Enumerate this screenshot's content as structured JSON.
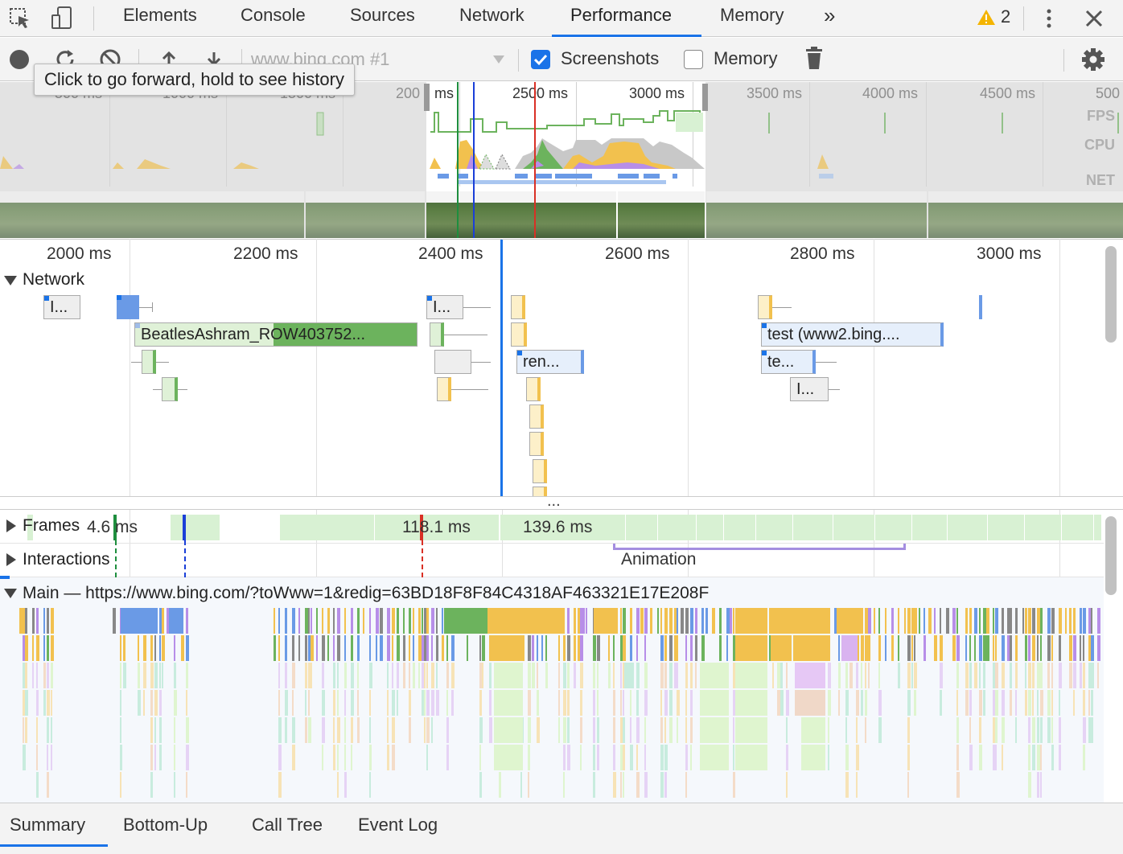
{
  "tabs": [
    {
      "label": "Elements"
    },
    {
      "label": "Console"
    },
    {
      "label": "Sources"
    },
    {
      "label": "Network"
    },
    {
      "label": "Performance",
      "active": true
    },
    {
      "label": "Memory"
    }
  ],
  "more_tabs_label": "»",
  "warnings_count": "2",
  "tooltip": "Click to go forward, hold to see history",
  "toolbar": {
    "recording_select": "www.bing.com #1",
    "screenshots_label": "Screenshots",
    "screenshots_checked": true,
    "memory_label": "Memory",
    "memory_checked": false
  },
  "overview": {
    "ticks": [
      "500 ms",
      "1000 ms",
      "1500 ms",
      "200",
      "ms",
      "2500 ms",
      "3000 ms",
      "3500 ms",
      "4000 ms",
      "4500 ms",
      "500"
    ],
    "lanes": {
      "fps": "FPS",
      "cpu": "CPU",
      "net": "NET"
    }
  },
  "ruler": [
    "2000 ms",
    "2200 ms",
    "2400 ms",
    "2600 ms",
    "2800 ms",
    "3000 ms"
  ],
  "network": {
    "title": "Network",
    "requests": [
      {
        "label": "I..."
      },
      {
        "label": "I..."
      },
      {
        "label": "BeatlesAshram_ROW403752..."
      },
      {
        "label": "test (www2.bing...."
      },
      {
        "label": "ren..."
      },
      {
        "label": "te..."
      },
      {
        "label": "I..."
      }
    ]
  },
  "more_indicator": "...",
  "tracks": {
    "frames_label": "Frames",
    "frame_times": [
      "4.6 ms",
      "118.1 ms",
      "139.6 ms"
    ],
    "interactions_label": "Interactions",
    "animation_label": "Animation",
    "main_label": "Main — https://www.bing.com/?toWww=1&redig=63BD18F8F84C4318AF463321E17E208F"
  },
  "bottom_tabs": [
    "Summary",
    "Bottom-Up",
    "Call Tree",
    "Event Log"
  ],
  "colors": {
    "accent": "#1a73e8",
    "scripting": "#f2c14e",
    "rendering": "#b78ee8",
    "painting": "#6cb35d",
    "loading": "#6a9ae6",
    "frame": "#d8f1d3"
  }
}
